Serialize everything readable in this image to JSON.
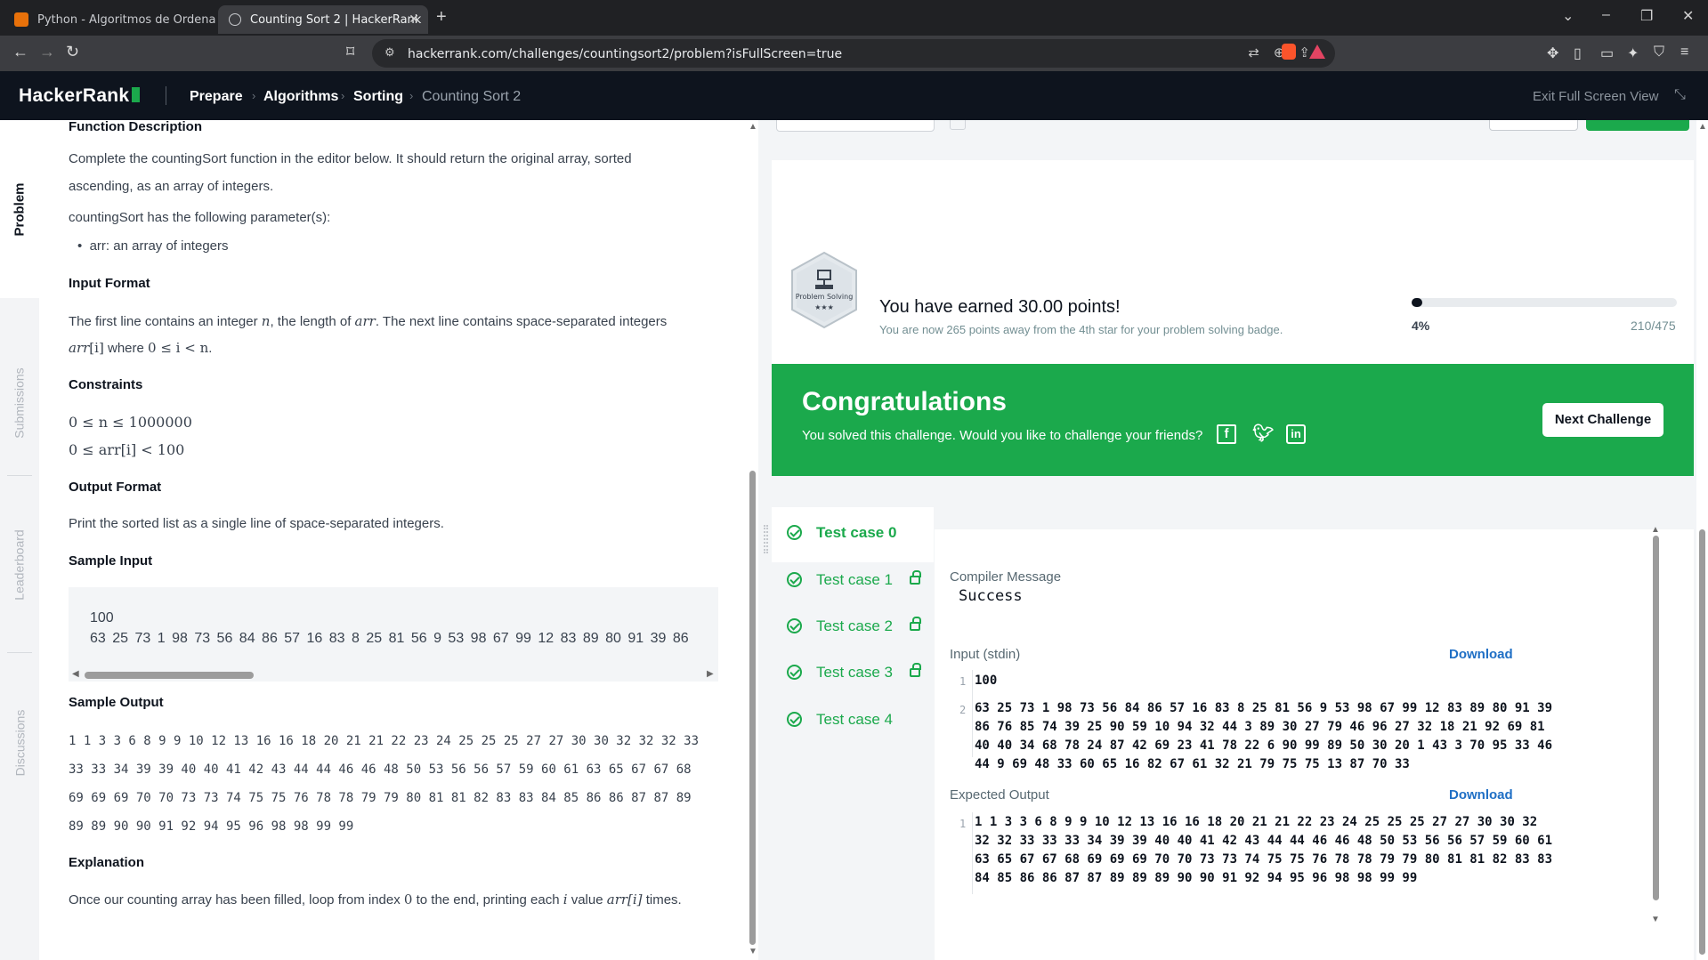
{
  "browser": {
    "tabs": [
      {
        "title": "Python - Algoritmos de Ordenamie"
      },
      {
        "title": "Counting Sort 2 | HackerRank"
      }
    ],
    "url": "hackerrank.com/challenges/countingsort2/problem?isFullScreen=true"
  },
  "header": {
    "logo": "HackerRank",
    "breadcrumbs": [
      "Prepare",
      "Algorithms",
      "Sorting",
      "Counting Sort 2"
    ],
    "exit_fullscreen": "Exit Full Screen View"
  },
  "sidetabs": [
    "Problem",
    "Submissions",
    "Leaderboard",
    "Discussions"
  ],
  "problem": {
    "function_description_heading": "Function Description",
    "function_description_l1": "Complete the countingSort function in the editor below. It should return the original array, sorted",
    "function_description_l2": "ascending, as an array of integers.",
    "params_intro": "countingSort has the following parameter(s):",
    "param_arr": "arr: an array of integers",
    "input_format_heading": "Input Format",
    "input_format_a": "The first line contains an integer ",
    "input_format_n": "n",
    "input_format_b": ", the length of ",
    "input_format_arr": "arr",
    "input_format_c": ". The next line contains space-separated integers",
    "input_format_l2_arr": "arr",
    "input_format_l2_i": "[i]",
    "input_format_l2_where": " where ",
    "input_format_l2_cond": "0 ≤ i < n",
    "input_format_l2_end": ".",
    "constraints_heading": "Constraints",
    "constraint1": "0 ≤ n ≤ 1000000",
    "constraint2": "0 ≤ arr[i] < 100",
    "output_format_heading": "Output Format",
    "output_format_text": "Print the sorted list as a single line of space-separated integers.",
    "sample_input_heading": "Sample Input",
    "sample_input_l1": "100",
    "sample_input_l2": "63 25 73 1 98 73 56 84 86 57 16 83 8 25 81 56 9 53 98 67 99 12 83 89 80 91 39 86",
    "sample_output_heading": "Sample Output",
    "sample_output_lines": [
      "1 1 3 3 6 8 9 9 10 12 13 16 16 18 20 21 21 22 23 24 25 25 25 27 27 30 30 32 32 32 33",
      "33 33 34 39 39 40 40 41 42 43 44 44 46 46 48 50 53 56 56 57 59 60 61 63 65 67 67 68",
      "69 69 69 70 70 73 73 74 75 75 76 78 78 79 79 80 81 81 82 83 83 84 85 86 86 87 87 89",
      "89 89 90 90 91 92 94 95 96 98 98 99 99"
    ],
    "explanation_heading": "Explanation",
    "explanation_a": "Once our counting array has been filled, loop from index ",
    "explanation_zero": "0",
    "explanation_b": " to the end, printing each ",
    "explanation_i": "i",
    "explanation_c": " value ",
    "explanation_arr": "arr[i]",
    "explanation_d": " times."
  },
  "result": {
    "badge_label": "Problem Solving",
    "badge_stars": "★★★",
    "earned": "You have earned 30.00 points!",
    "earned_sub": "You are now 265 points away from the 4th star for your problem solving badge.",
    "progress_fraction": 0.04,
    "progress_pct": "4%",
    "progress_count": "210/475",
    "congrats_title": "Congratulations",
    "congrats_sub": "You solved this challenge. Would you like to challenge your friends?",
    "next_challenge": "Next Challenge"
  },
  "testcases": [
    {
      "label": "Test case 0",
      "locked": false
    },
    {
      "label": "Test case 1",
      "locked": true
    },
    {
      "label": "Test case 2",
      "locked": true
    },
    {
      "label": "Test case 3",
      "locked": true
    },
    {
      "label": "Test case 4",
      "locked": false
    }
  ],
  "output": {
    "compiler_label": "Compiler Message",
    "compiler_msg": "Success",
    "input_label": "Input (stdin)",
    "download": "Download",
    "input_line1_no": "1",
    "input_line1": "100",
    "input_line2_no": "2",
    "input_line2": "63 25 73 1 98 73 56 84 86 57 16 83 8 25 81 56 9 53 98 67 99 12 83 89 80 91 39\n86 76 85 74 39 25 90 59 10 94 32 44 3 89 30 27 79 46 96 27 32 18 21 92 69 81\n40 40 34 68 78 24 87 42 69 23 41 78 22 6 90 99 89 50 30 20 1 43 3 70 95 33 46\n44 9 69 48 33 60 65 16 82 67 61 32 21 79 75 75 13 87 70 33",
    "expected_label": "Expected Output",
    "expected_line1_no": "1",
    "expected_line1": "1 1 3 3 6 8 9 9 10 12 13 16 16 18 20 21 21 22 23 24 25 25 25 27 27 30 30 32\n32 32 33 33 33 34 39 39 40 40 41 42 43 44 44 46 46 48 50 53 56 56 57 59 60 61\n63 65 67 67 68 69 69 69 70 70 73 73 74 75 75 76 78 78 79 79 80 81 81 82 83 83\n84 85 86 86 87 87 89 89 89 90 90 91 92 94 95 96 98 98 99 99"
  }
}
